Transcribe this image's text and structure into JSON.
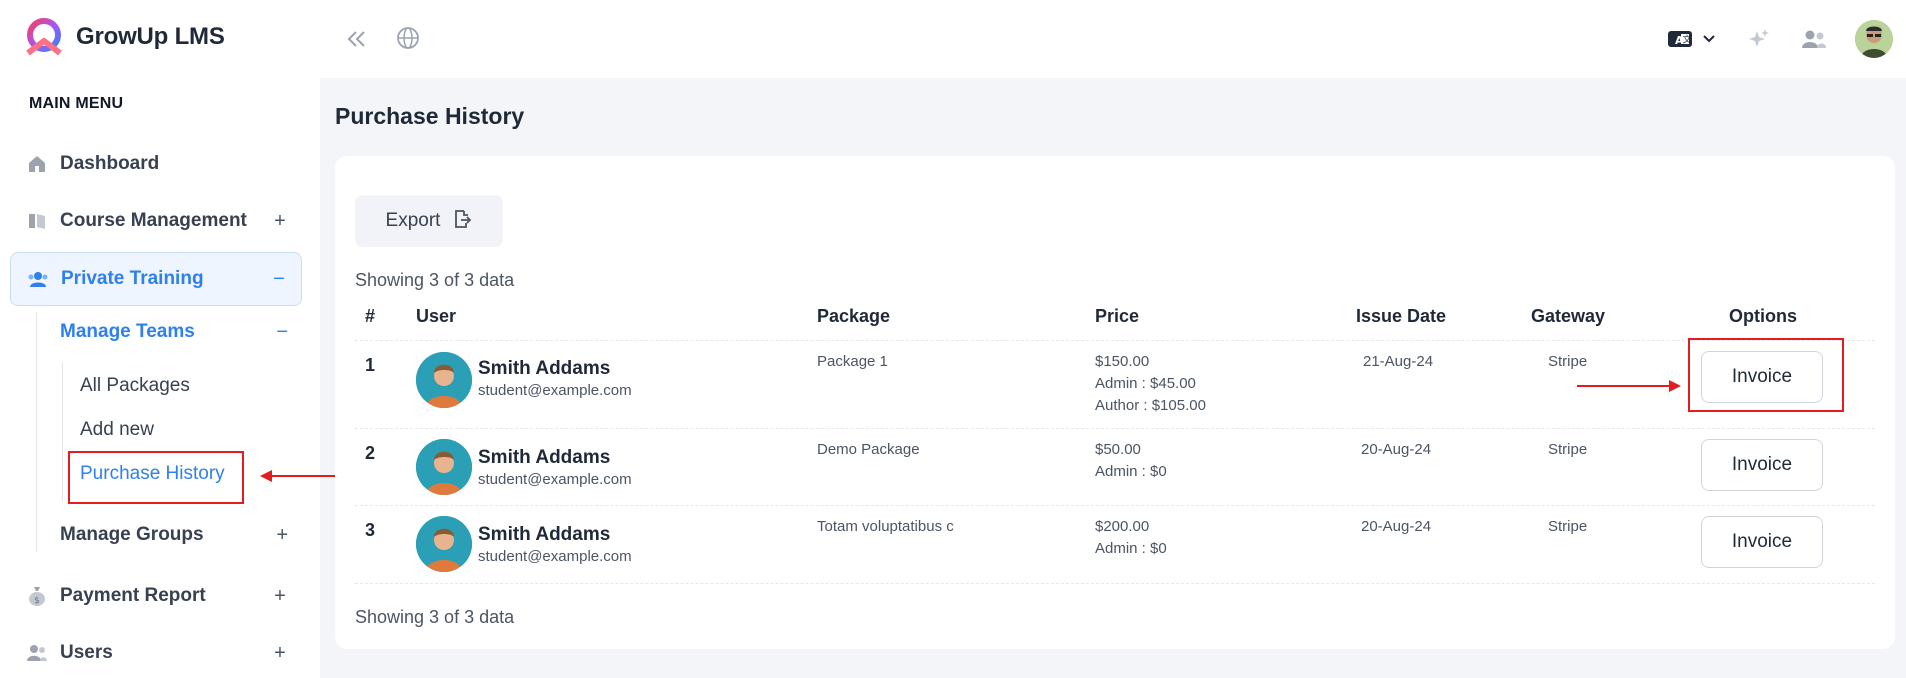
{
  "app": {
    "name": "GrowUp LMS"
  },
  "sidebar": {
    "section_title": "MAIN MENU",
    "items": [
      {
        "label": "Dashboard",
        "icon": "home-icon",
        "toggle": ""
      },
      {
        "label": "Course Management",
        "icon": "book-icon",
        "toggle": "+"
      },
      {
        "label": "Private Training",
        "icon": "users-icon",
        "toggle": "−"
      },
      {
        "label": "Payment Report",
        "icon": "money-bag-icon",
        "toggle": "+"
      },
      {
        "label": "Users",
        "icon": "user-group-icon",
        "toggle": "+"
      }
    ],
    "private_training": {
      "manage_teams": {
        "label": "Manage Teams",
        "toggle": "−"
      },
      "sub_items": [
        "All Packages",
        "Add new",
        "Purchase History"
      ],
      "manage_groups": {
        "label": "Manage Groups",
        "toggle": "+"
      }
    }
  },
  "topbar": {
    "icons": [
      "collapse-icon",
      "globe-icon",
      "translate-icon",
      "chevron-down-icon",
      "sparkle-icon",
      "users-icon",
      "avatar"
    ]
  },
  "page": {
    "title": "Purchase History",
    "export_label": "Export",
    "showing_top": "Showing 3 of 3 data",
    "showing_bottom": "Showing 3 of 3 data"
  },
  "table": {
    "headers": [
      "#",
      "User",
      "Package",
      "Price",
      "Issue Date",
      "Gateway",
      "Options"
    ],
    "rows": [
      {
        "num": "1",
        "name": "Smith Addams",
        "email": "student@example.com",
        "package": "Package 1",
        "price": [
          "$150.00",
          "Admin : $45.00",
          "Author : $105.00"
        ],
        "date": "21-Aug-24",
        "gateway": "Stripe",
        "option": "Invoice"
      },
      {
        "num": "2",
        "name": "Smith Addams",
        "email": "student@example.com",
        "package": "Demo Package",
        "price": [
          "$50.00",
          "Admin : $0"
        ],
        "date": "20-Aug-24",
        "gateway": "Stripe",
        "option": "Invoice"
      },
      {
        "num": "3",
        "name": "Smith Addams",
        "email": "student@example.com",
        "package": "Totam voluptatibus c",
        "price": [
          "$200.00",
          "Admin : $0"
        ],
        "date": "20-Aug-24",
        "gateway": "Stripe",
        "option": "Invoice"
      }
    ]
  },
  "colors": {
    "accent": "#2f80ed",
    "annotation": "#e11d1d"
  }
}
